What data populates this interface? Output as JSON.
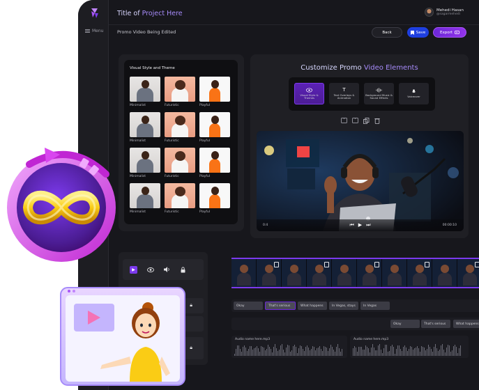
{
  "header": {
    "title_prefix": "Title of ",
    "title_accent": "Project Here",
    "menu_label": "Menu",
    "user_name": "Mehedi Hasan",
    "user_handle": "@sagarmehedi"
  },
  "subheader": {
    "title": "Promo Video Being Edited",
    "back_label": "Back",
    "save_label": "Save",
    "export_label": "Export"
  },
  "style_panel": {
    "title": "Visual Style and Theme",
    "thumbnails": [
      {
        "label": "Minimalist",
        "style": "min"
      },
      {
        "label": "Futuristic",
        "style": "fut"
      },
      {
        "label": "Playful",
        "style": "play"
      },
      {
        "label": "Minimalist",
        "style": "min"
      },
      {
        "label": "Futuristic",
        "style": "fut"
      },
      {
        "label": "Playful",
        "style": "play"
      },
      {
        "label": "Minimalist",
        "style": "min"
      },
      {
        "label": "Futuristic",
        "style": "fut"
      },
      {
        "label": "Playful",
        "style": "play"
      },
      {
        "label": "Minimalist",
        "style": "min"
      },
      {
        "label": "Futuristic",
        "style": "fut"
      },
      {
        "label": "Playful",
        "style": "play"
      }
    ]
  },
  "customize": {
    "title_prefix": "Customize Promo ",
    "title_accent": "Video Elements",
    "tabs": [
      {
        "label": "Visual Style & Themes",
        "icon": "eye-icon",
        "active": true
      },
      {
        "label": "Text Overlays & Animation",
        "icon": "text-icon",
        "active": false
      },
      {
        "label": "Background Music & Sound Effects",
        "icon": "waveform-icon",
        "active": false
      },
      {
        "label": "Voiceover",
        "icon": "mic-icon",
        "active": false
      }
    ],
    "video": {
      "time_elapsed": "0:4",
      "time_total": "00:00:10"
    }
  },
  "timeline": {
    "text_track": [
      "Okay",
      "That's serious",
      "What happens",
      "In Vegas, stays",
      "In Vegas"
    ],
    "text_track_2": [
      "Okay",
      "That's serious",
      "What happens"
    ],
    "audio": [
      {
        "label": "Audio name here.mp3"
      },
      {
        "label": "Audio name here.mp3"
      }
    ]
  },
  "colors": {
    "accent": "#7c3aed",
    "save": "#1e3fe0",
    "panel": "#1f1f24",
    "background": "#17171c"
  }
}
